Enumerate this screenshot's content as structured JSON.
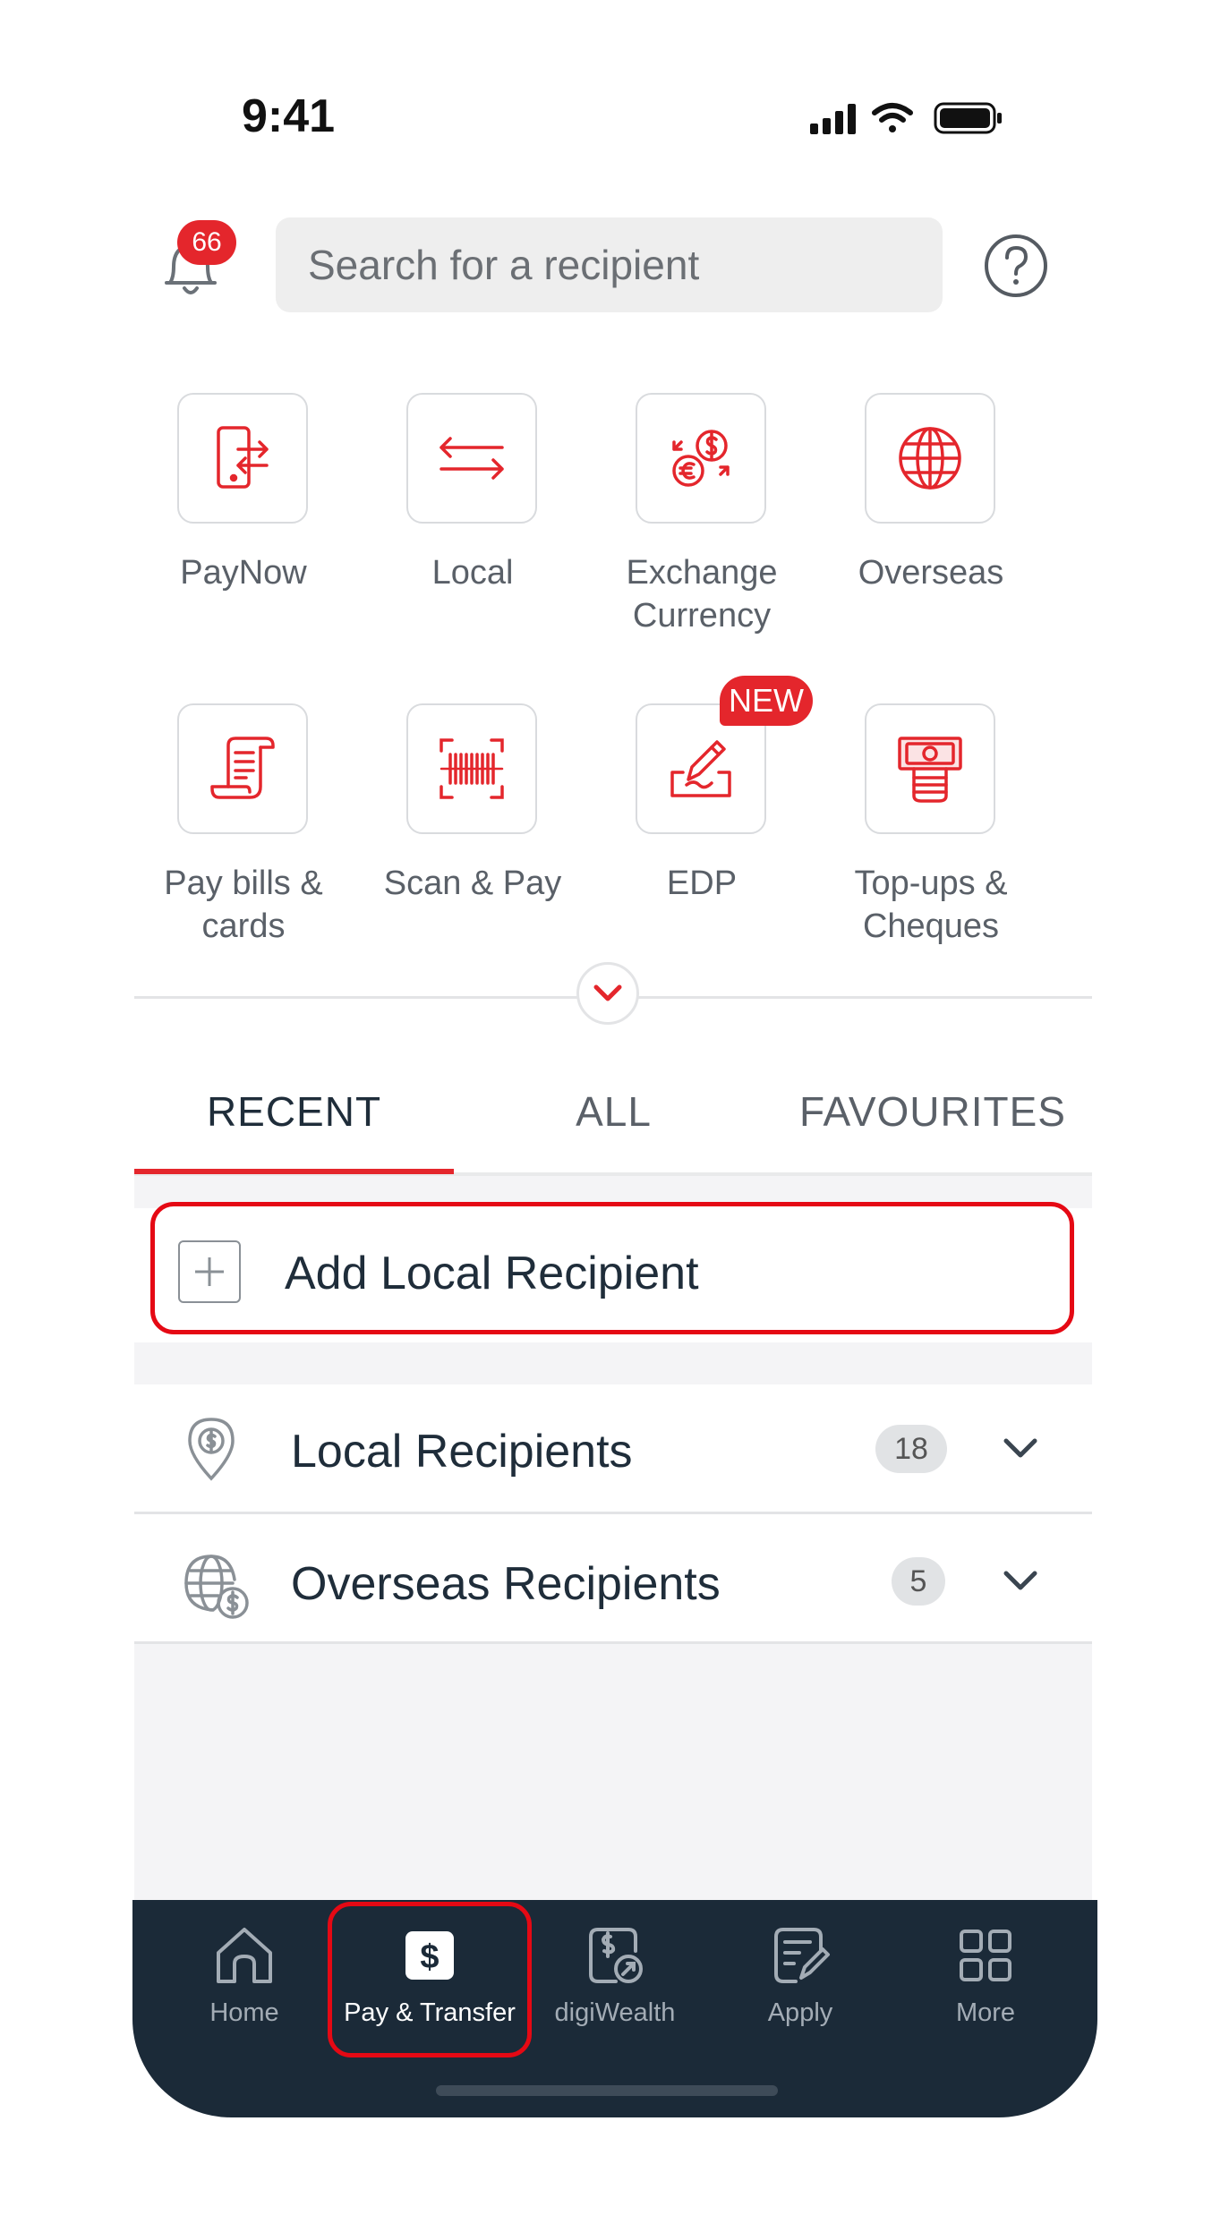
{
  "status_bar": {
    "time": "9:41"
  },
  "header": {
    "notification_count": "66",
    "search_placeholder": "Search for a recipient"
  },
  "quick_actions": [
    {
      "label": "PayNow",
      "icon": "paynow-icon"
    },
    {
      "label": "Local",
      "icon": "transfer-arrows-icon"
    },
    {
      "label": "Exchange Currency",
      "icon": "currency-exchange-icon"
    },
    {
      "label": "Overseas",
      "icon": "globe-icon"
    },
    {
      "label": "Pay bills & cards",
      "icon": "bill-receipt-icon"
    },
    {
      "label": "Scan & Pay",
      "icon": "barcode-scan-icon"
    },
    {
      "label": "EDP",
      "icon": "edp-sign-icon",
      "badge": "NEW"
    },
    {
      "label": "Top-ups & Cheques",
      "icon": "cash-topup-icon"
    }
  ],
  "tabs": [
    {
      "label": "RECENT",
      "active": true
    },
    {
      "label": "ALL",
      "active": false
    },
    {
      "label": "FAVOURITES",
      "active": false
    }
  ],
  "add_recipient": {
    "label": "Add Local Recipient"
  },
  "recipient_groups": [
    {
      "label": "Local Recipients",
      "count": "18",
      "icon": "location-dollar-icon"
    },
    {
      "label": "Overseas Recipients",
      "count": "5",
      "icon": "globe-dollar-icon"
    }
  ],
  "bottom_nav": [
    {
      "label": "Home",
      "icon": "home-icon",
      "active": false
    },
    {
      "label": "Pay & Transfer",
      "icon": "dollar-icon",
      "active": true
    },
    {
      "label": "digiWealth",
      "icon": "wealth-icon",
      "active": false
    },
    {
      "label": "Apply",
      "icon": "apply-form-icon",
      "active": false
    },
    {
      "label": "More",
      "icon": "grid-icon",
      "active": false
    }
  ],
  "colors": {
    "accent": "#e4262c",
    "nav_bg": "#1b2a38",
    "text_dark": "#1f2d3a"
  }
}
